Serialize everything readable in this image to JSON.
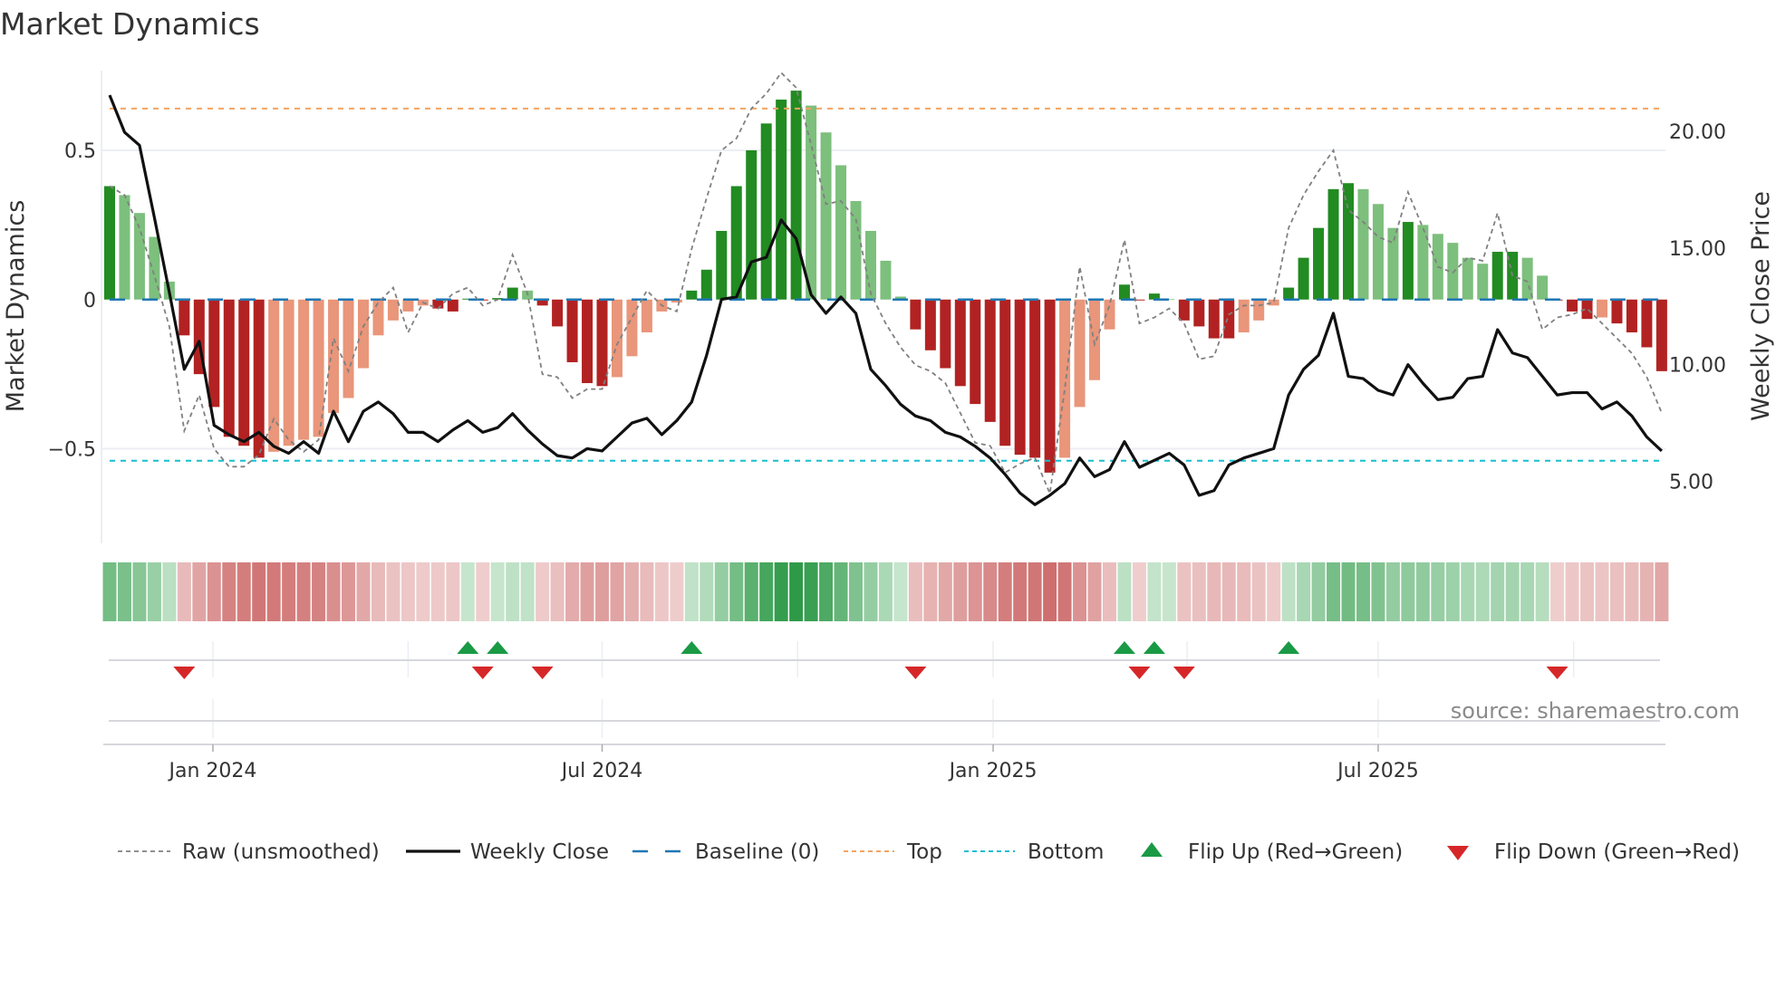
{
  "chart_data": {
    "type": "bar",
    "title": "Market Dynamics",
    "ylabel": "Market Dynamics",
    "y2label": "Weekly Close Price",
    "ylim": [
      -0.817,
      0.767
    ],
    "y2lim": [
      2.34,
      22.6
    ],
    "yticks": [
      {
        "v": 0.5,
        "label": "0.5"
      },
      {
        "v": 0,
        "label": "0"
      },
      {
        "v": -0.5,
        "label": "−0.5"
      }
    ],
    "y2ticks": [
      {
        "v": 20,
        "label": "20.00"
      },
      {
        "v": 15,
        "label": "15.00"
      },
      {
        "v": 10,
        "label": "10.00"
      },
      {
        "v": 5,
        "label": "5.00"
      }
    ],
    "xticks": [
      {
        "idx": 6.92,
        "label": "Jan 2024"
      },
      {
        "idx": 33.0,
        "label": "Jul 2024"
      },
      {
        "idx": 59.2,
        "label": "Jan 2025"
      },
      {
        "idx": 85.0,
        "label": "Jul 2025"
      }
    ],
    "minor_grid_idx": [
      20.0,
      46.1,
      72.2,
      98.1
    ],
    "top_level": 0.64,
    "bottom_level": -0.54,
    "baseline": 0,
    "momentum": [
      0.38,
      0.35,
      0.29,
      0.21,
      0.06,
      -0.12,
      -0.25,
      -0.36,
      -0.46,
      -0.49,
      -0.53,
      -0.51,
      -0.49,
      -0.47,
      -0.46,
      -0.38,
      -0.33,
      -0.23,
      -0.12,
      -0.07,
      -0.04,
      -0.02,
      -0.03,
      -0.04,
      0.003,
      -0.003,
      0.005,
      0.04,
      0.03,
      -0.02,
      -0.09,
      -0.21,
      -0.28,
      -0.29,
      -0.26,
      -0.19,
      -0.11,
      -0.04,
      -0.01,
      0.03,
      0.1,
      0.23,
      0.38,
      0.5,
      0.59,
      0.67,
      0.7,
      0.65,
      0.56,
      0.45,
      0.33,
      0.23,
      0.13,
      0.01,
      -0.1,
      -0.17,
      -0.23,
      -0.29,
      -0.35,
      -0.41,
      -0.49,
      -0.52,
      -0.53,
      -0.58,
      -0.53,
      -0.36,
      -0.27,
      -0.1,
      0.05,
      -0.003,
      0.02,
      0.002,
      -0.07,
      -0.09,
      -0.13,
      -0.13,
      -0.11,
      -0.07,
      -0.02,
      0.04,
      0.14,
      0.24,
      0.37,
      0.39,
      0.37,
      0.32,
      0.24,
      0.26,
      0.25,
      0.22,
      0.19,
      0.14,
      0.12,
      0.16,
      0.16,
      0.14,
      0.08,
      -0.003,
      -0.04,
      -0.065,
      -0.06,
      -0.08,
      -0.11,
      -0.16,
      -0.24
    ],
    "raw": [
      0.38,
      0.35,
      0.24,
      0.08,
      -0.09,
      -0.44,
      -0.32,
      -0.5,
      -0.56,
      -0.56,
      -0.52,
      -0.4,
      -0.47,
      -0.51,
      -0.47,
      -0.13,
      -0.24,
      -0.09,
      -0.01,
      0.04,
      -0.11,
      -0.01,
      -0.03,
      0.02,
      0.04,
      -0.02,
      0.0,
      0.15,
      0.02,
      -0.25,
      -0.26,
      -0.33,
      -0.3,
      -0.3,
      -0.15,
      -0.06,
      0.03,
      -0.02,
      -0.04,
      0.17,
      0.34,
      0.5,
      0.54,
      0.64,
      0.69,
      0.76,
      0.71,
      0.52,
      0.32,
      0.33,
      0.27,
      0.02,
      -0.08,
      -0.16,
      -0.22,
      -0.24,
      -0.28,
      -0.38,
      -0.48,
      -0.49,
      -0.58,
      -0.55,
      -0.53,
      -0.65,
      -0.3,
      0.11,
      -0.15,
      -0.02,
      0.2,
      -0.08,
      -0.06,
      -0.03,
      -0.08,
      -0.2,
      -0.19,
      -0.05,
      -0.02,
      -0.02,
      -0.01,
      0.24,
      0.35,
      0.43,
      0.5,
      0.3,
      0.26,
      0.21,
      0.19,
      0.36,
      0.24,
      0.11,
      0.09,
      0.14,
      0.13,
      0.29,
      0.08,
      0.06,
      -0.1,
      -0.06,
      -0.05,
      -0.03,
      -0.08,
      -0.13,
      -0.18,
      -0.26,
      -0.38
    ],
    "weekly_close": [
      21.55,
      19.96,
      19.4,
      16.3,
      13.1,
      9.8,
      11.0,
      7.4,
      7.0,
      6.7,
      7.1,
      6.5,
      6.2,
      6.7,
      6.2,
      8.0,
      6.7,
      8.0,
      8.4,
      7.9,
      7.1,
      7.1,
      6.7,
      7.2,
      7.6,
      7.1,
      7.3,
      7.9,
      7.2,
      6.6,
      6.1,
      6.0,
      6.4,
      6.3,
      6.9,
      7.5,
      7.7,
      7.0,
      7.6,
      8.4,
      10.4,
      12.8,
      12.9,
      14.4,
      14.6,
      16.2,
      15.4,
      13.0,
      12.2,
      12.9,
      12.2,
      9.8,
      9.1,
      8.3,
      7.8,
      7.6,
      7.1,
      6.9,
      6.5,
      6.0,
      5.3,
      4.5,
      4.0,
      4.4,
      4.9,
      6.0,
      5.2,
      5.5,
      6.7,
      5.6,
      5.9,
      6.2,
      5.7,
      4.4,
      4.6,
      5.7,
      6.0,
      6.2,
      6.4,
      8.7,
      9.8,
      10.4,
      12.2,
      9.5,
      9.4,
      8.9,
      8.7,
      10.0,
      9.2,
      8.5,
      8.6,
      9.4,
      9.5,
      11.5,
      10.5,
      10.3,
      9.5,
      8.7,
      8.8,
      8.8,
      8.1,
      8.4,
      7.8,
      6.9,
      6.3
    ],
    "flip_up_idx": [
      24,
      26,
      39,
      68,
      70,
      79
    ],
    "flip_down_idx": [
      5,
      25,
      29,
      54,
      69,
      72,
      97
    ],
    "legend": {
      "placement": "bottom",
      "items": [
        {
          "key": "raw",
          "label": "Raw (unsmoothed)"
        },
        {
          "key": "close",
          "label": "Weekly Close"
        },
        {
          "key": "baseline",
          "label": "Baseline (0)"
        },
        {
          "key": "top",
          "label": "Top"
        },
        {
          "key": "bottom",
          "label": "Bottom"
        },
        {
          "key": "flipup",
          "label": "Flip Up (Red→Green)"
        },
        {
          "key": "flipdown",
          "label": "Flip Down (Green→Red)"
        }
      ]
    },
    "source": "source: sharemaestro.com",
    "colors": {
      "dark_green": "#228b22",
      "light_green": "#7dbf7d",
      "dark_red": "#b22222",
      "light_red": "#e9967a",
      "top": "#f4a460",
      "bottom": "#17becf",
      "baseline": "#1f77b4",
      "raw": "#808080",
      "close": "#111111",
      "flip_up": "#1a9a45",
      "flip_down": "#d62728"
    }
  }
}
